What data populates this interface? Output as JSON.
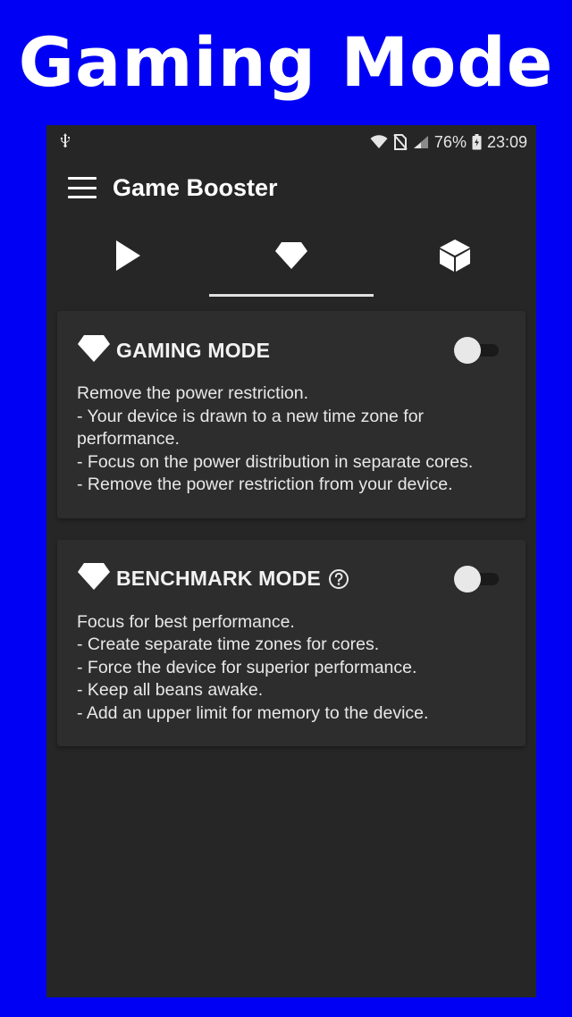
{
  "banner": {
    "title": "Gaming Mode"
  },
  "status_bar": {
    "battery": "76%",
    "time": "23:09"
  },
  "app_bar": {
    "title": "Game Booster"
  },
  "tabs": [
    {
      "icon": "play-icon",
      "selected": false
    },
    {
      "icon": "diamond-icon",
      "selected": true
    },
    {
      "icon": "cube-icon",
      "selected": false
    }
  ],
  "cards": [
    {
      "title": "GAMING MODE",
      "enabled": false,
      "lines": [
        "Remove the power restriction.",
        "- Your device is drawn to a new time zone for performance.",
        "- Focus on the power distribution in separate cores.",
        "- Remove the power restriction from your device."
      ]
    },
    {
      "title": "BENCHMARK MODE",
      "enabled": false,
      "lines": [
        "Focus for best performance.",
        "- Create separate time zones for cores.",
        "- Force the device for superior performance.",
        "- Keep all beans awake.",
        "- Add an upper limit for memory to the device."
      ]
    }
  ],
  "colors": {
    "background": "#0000f5",
    "surface": "#262626",
    "card": "#2d2d2d",
    "text": "#ffffff"
  }
}
